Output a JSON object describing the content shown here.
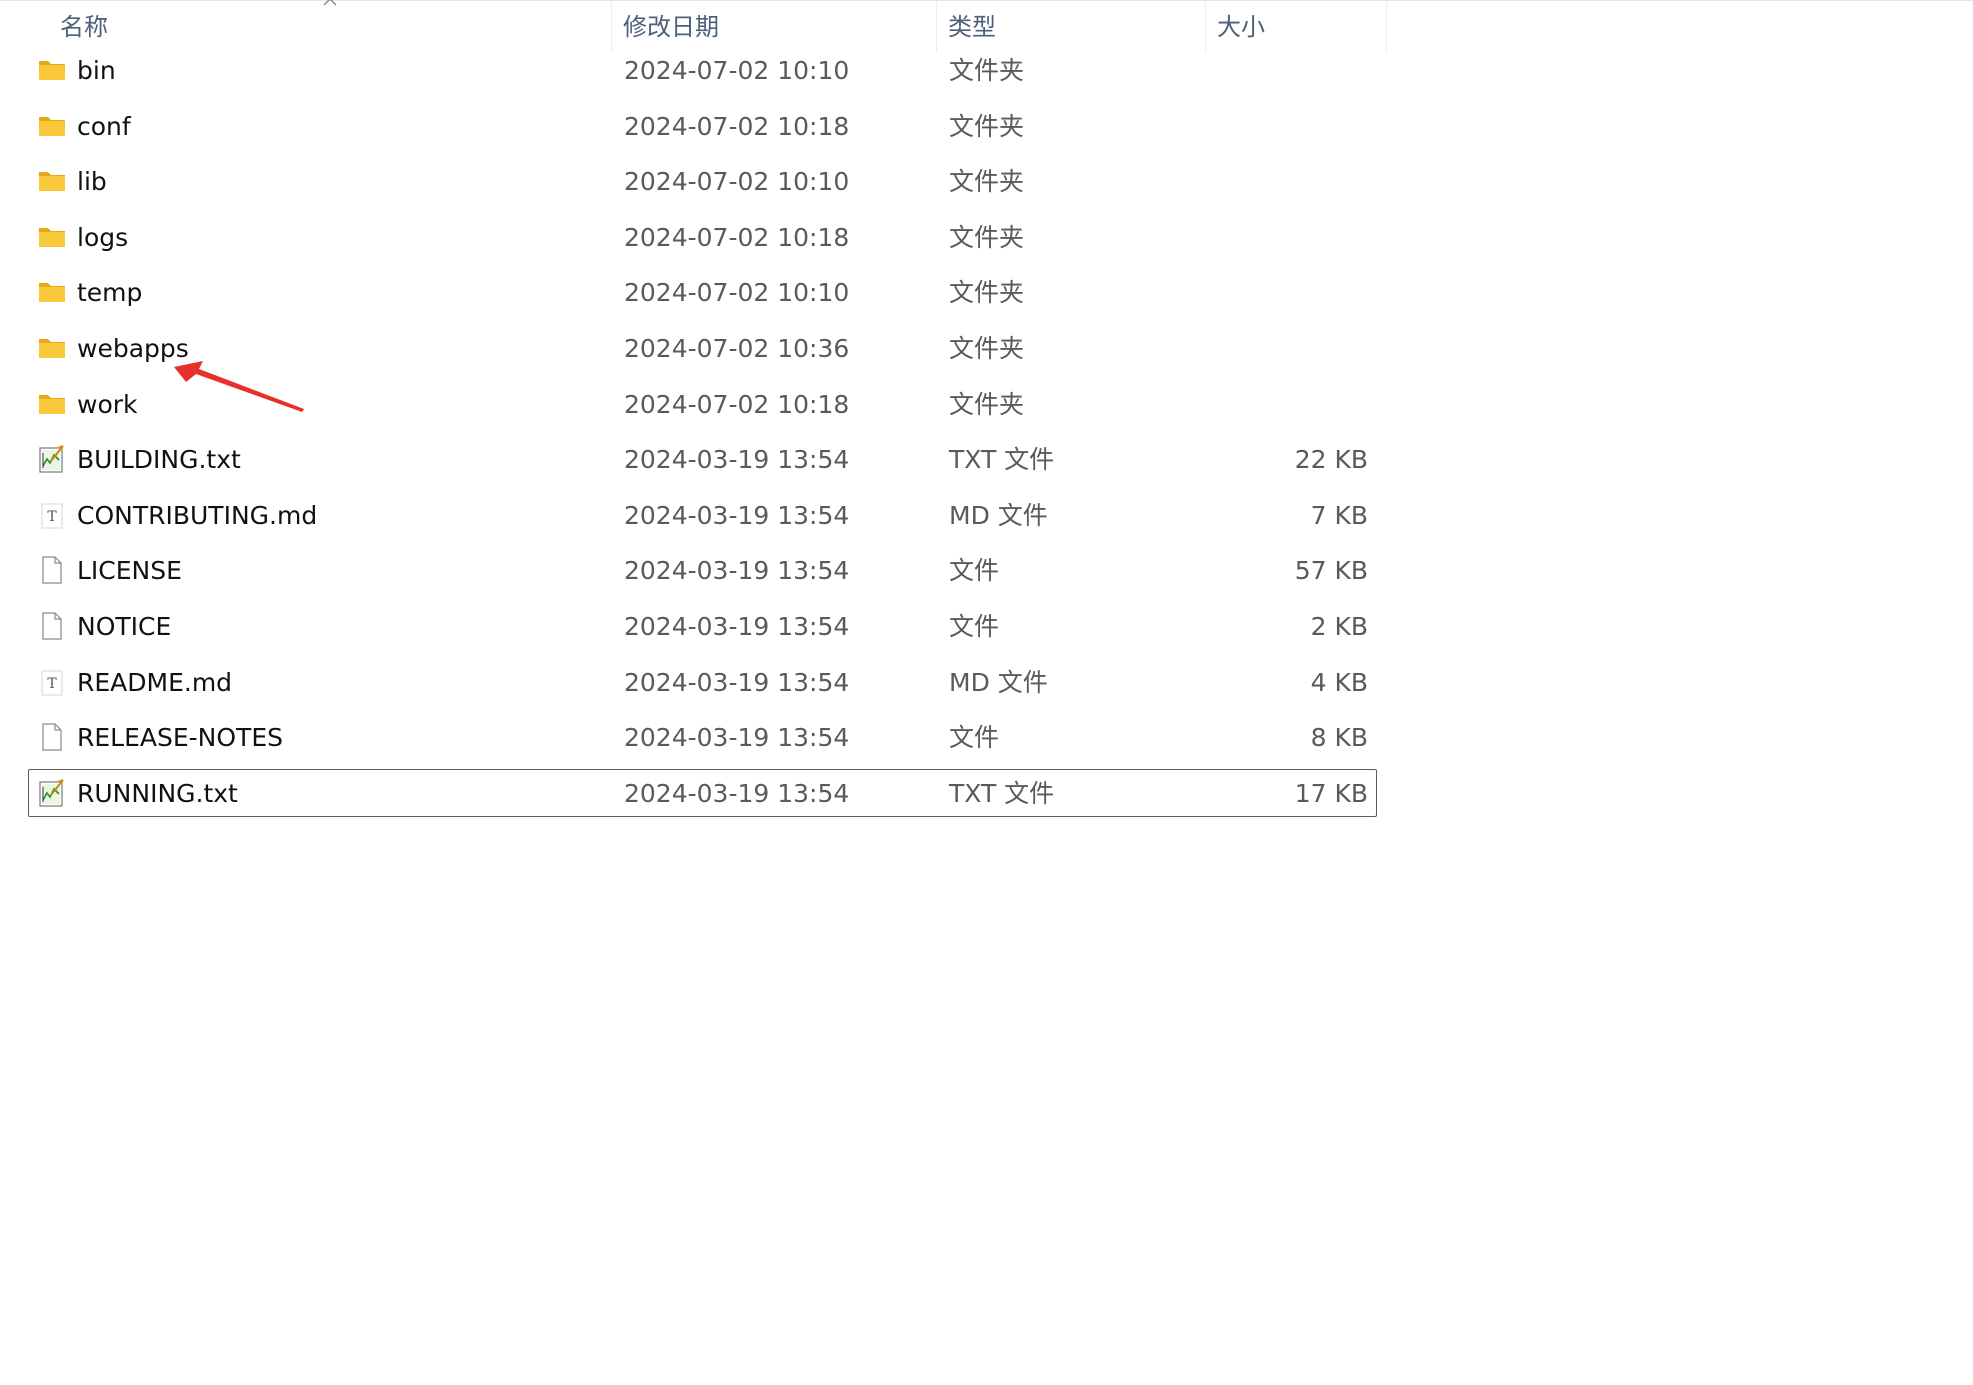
{
  "columns": {
    "name": "名称",
    "date": "修改日期",
    "type": "类型",
    "size": "大小"
  },
  "files": [
    {
      "name": "bin",
      "date": "2024-07-02 10:10",
      "type": "文件夹",
      "size": "",
      "icon": "folder-icon"
    },
    {
      "name": "conf",
      "date": "2024-07-02 10:18",
      "type": "文件夹",
      "size": "",
      "icon": "folder-icon"
    },
    {
      "name": "lib",
      "date": "2024-07-02 10:10",
      "type": "文件夹",
      "size": "",
      "icon": "folder-icon"
    },
    {
      "name": "logs",
      "date": "2024-07-02 10:18",
      "type": "文件夹",
      "size": "",
      "icon": "folder-icon"
    },
    {
      "name": "temp",
      "date": "2024-07-02 10:10",
      "type": "文件夹",
      "size": "",
      "icon": "folder-icon"
    },
    {
      "name": "webapps",
      "date": "2024-07-02 10:36",
      "type": "文件夹",
      "size": "",
      "icon": "folder-icon"
    },
    {
      "name": "work",
      "date": "2024-07-02 10:18",
      "type": "文件夹",
      "size": "",
      "icon": "folder-icon"
    },
    {
      "name": "BUILDING.txt",
      "date": "2024-03-19 13:54",
      "type": "TXT 文件",
      "size": "22 KB",
      "icon": "txt-file-icon"
    },
    {
      "name": "CONTRIBUTING.md",
      "date": "2024-03-19 13:54",
      "type": "MD 文件",
      "size": "7 KB",
      "icon": "md-file-icon"
    },
    {
      "name": "LICENSE",
      "date": "2024-03-19 13:54",
      "type": "文件",
      "size": "57 KB",
      "icon": "blank-file-icon"
    },
    {
      "name": "NOTICE",
      "date": "2024-03-19 13:54",
      "type": "文件",
      "size": "2 KB",
      "icon": "blank-file-icon"
    },
    {
      "name": "README.md",
      "date": "2024-03-19 13:54",
      "type": "MD 文件",
      "size": "4 KB",
      "icon": "md-file-icon"
    },
    {
      "name": "RELEASE-NOTES",
      "date": "2024-03-19 13:54",
      "type": "文件",
      "size": "8 KB",
      "icon": "blank-file-icon"
    },
    {
      "name": "RUNNING.txt",
      "date": "2024-03-19 13:54",
      "type": "TXT 文件",
      "size": "17 KB",
      "icon": "txt-file-icon",
      "selected": true
    }
  ],
  "colors": {
    "header_text": "#4c607a",
    "selection_border": "#5a5a5a",
    "folder_yellow": "#f8c93b",
    "annotation_arrow": "#e8302a"
  }
}
